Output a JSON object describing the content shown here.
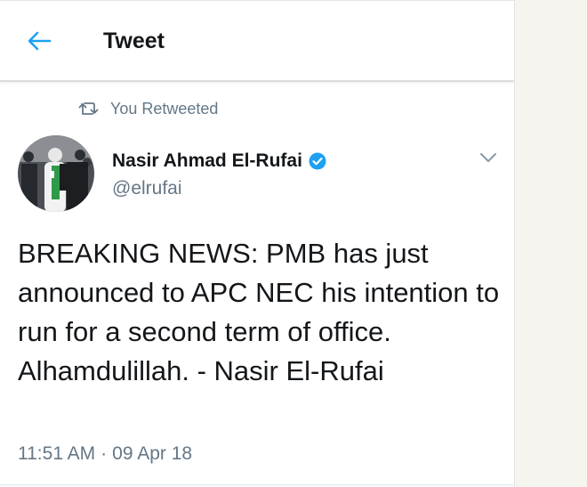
{
  "header": {
    "title": "Tweet",
    "back_icon": "arrow-left-icon"
  },
  "retweet_context": {
    "icon": "retweet-icon",
    "text": "You Retweeted"
  },
  "tweet": {
    "author_name": "Nasir Ahmad El-Rufai",
    "handle": "@elrufai",
    "verified_icon": "verified-badge-icon",
    "menu_icon": "chevron-down-icon",
    "text": "BREAKING NEWS: PMB has just announced to APC NEC his intention to run for a second term of office. Alhamdulillah. - Nasir El-Rufai",
    "time": "11:51 AM",
    "separator": "·",
    "date": "09 Apr 18"
  },
  "colors": {
    "accent": "#1da1f2",
    "text_primary": "#14171a",
    "text_secondary": "#657786"
  }
}
